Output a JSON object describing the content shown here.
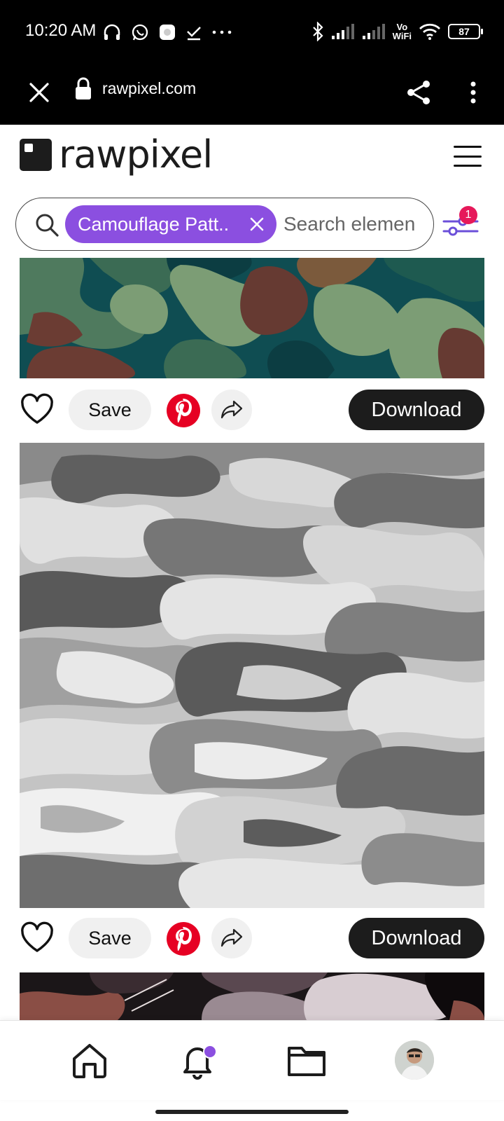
{
  "status_bar": {
    "time": "10:20 AM",
    "battery": "87",
    "network_label_top": "Vo",
    "network_label_bottom": "WiFi"
  },
  "browser": {
    "url": "rawpixel.com"
  },
  "site": {
    "logo_text": "rawpixel"
  },
  "search": {
    "chip_label": "Camouflage Patt..",
    "placeholder": "Search elemen",
    "filter_count": "1"
  },
  "posts": [
    {
      "save_label": "Save",
      "download_label": "Download"
    },
    {
      "save_label": "Save",
      "download_label": "Download"
    }
  ],
  "colors": {
    "accent_purple": "#8b4fe0",
    "badge_pink": "#e6195a",
    "pinterest_red": "#e60023",
    "download_bg": "#1c1c1c"
  }
}
